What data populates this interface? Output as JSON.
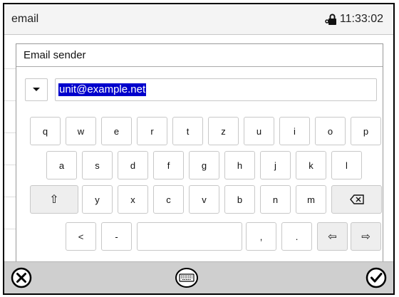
{
  "status": {
    "title": "email",
    "time": "11:33:02"
  },
  "dialog": {
    "title": "Email sender"
  },
  "input": {
    "value": "unit@example.net"
  },
  "keyboard": {
    "row1": [
      "q",
      "w",
      "e",
      "r",
      "t",
      "z",
      "u",
      "i",
      "o",
      "p"
    ],
    "row2": [
      "a",
      "s",
      "d",
      "f",
      "g",
      "h",
      "j",
      "k",
      "l"
    ],
    "row3_letters": [
      "y",
      "x",
      "c",
      "v",
      "b",
      "n",
      "m"
    ],
    "shift": "⇧",
    "backspace": "⌫",
    "row4": {
      "less": "<",
      "dash": "-",
      "comma": ",",
      "period": ".",
      "left": "⇦",
      "right": "⇨"
    }
  },
  "colors": {
    "selection": "#0000cc",
    "bar": "#cfcfcf"
  }
}
